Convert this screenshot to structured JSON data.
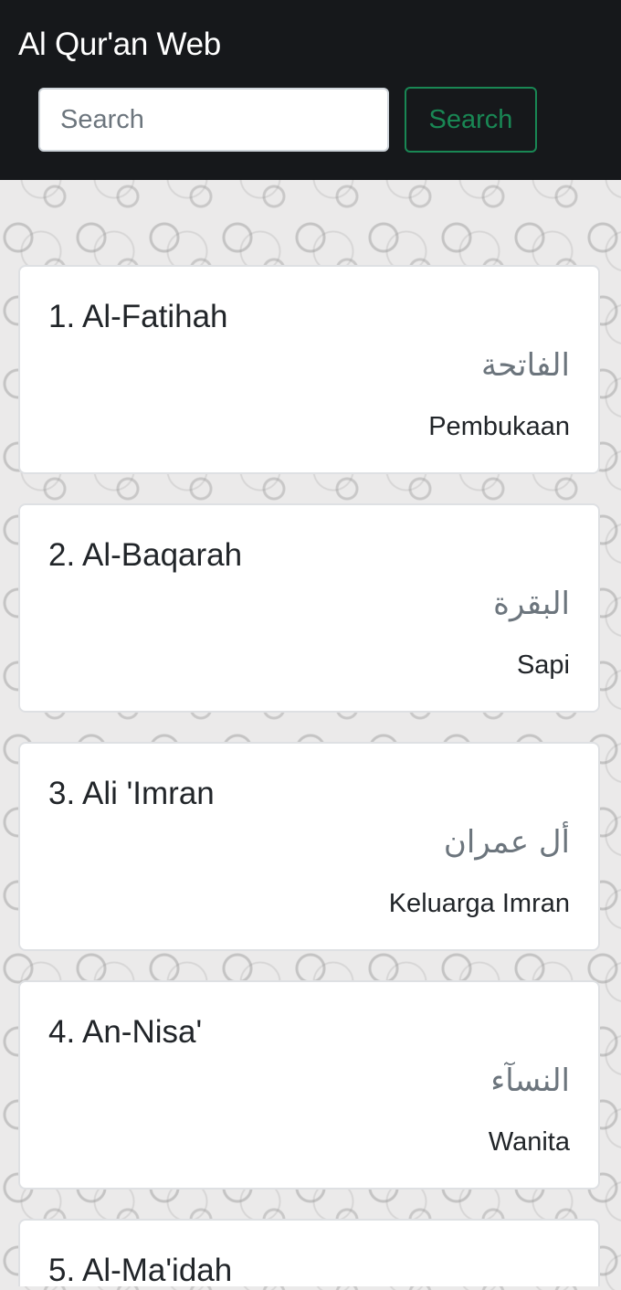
{
  "navbar": {
    "brand": "Al Qur'an Web",
    "search": {
      "placeholder": "Search",
      "value": ""
    },
    "search_button": "Search"
  },
  "surahs": [
    {
      "title": "1. Al-Fatihah",
      "arabic": "الفاتحة",
      "meaning": "Pembukaan"
    },
    {
      "title": "2. Al-Baqarah",
      "arabic": "البقرة",
      "meaning": "Sapi"
    },
    {
      "title": "3. Ali 'Imran",
      "arabic": "أل عمران",
      "meaning": "Keluarga Imran"
    },
    {
      "title": "4. An-Nisa'",
      "arabic": "النسآء",
      "meaning": "Wanita"
    },
    {
      "title": "5. Al-Ma'idah",
      "arabic": "",
      "meaning": ""
    }
  ],
  "colors": {
    "navbar_bg": "#16181b",
    "search_button_accent": "#198754",
    "arabic_text": "#6c757d"
  }
}
